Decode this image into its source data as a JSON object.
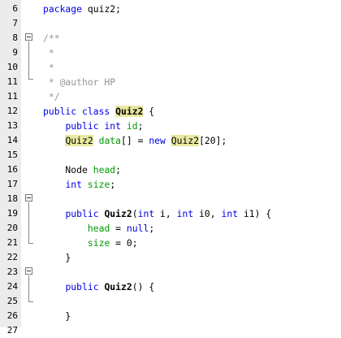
{
  "editor": {
    "lines": [
      {
        "n": "6",
        "parts": [
          [
            "kw",
            "package"
          ],
          [
            "t",
            " quiz2;"
          ]
        ]
      },
      {
        "n": "7",
        "parts": []
      },
      {
        "n": "8",
        "parts": [
          [
            "cm",
            "/**"
          ]
        ]
      },
      {
        "n": "9",
        "parts": [
          [
            "cm",
            " *"
          ]
        ]
      },
      {
        "n": "10",
        "parts": [
          [
            "cm",
            " *"
          ]
        ]
      },
      {
        "n": "11",
        "parts": [
          [
            "cm",
            " * @author HP"
          ]
        ]
      },
      {
        "n": "11",
        "parts": [
          [
            "cm",
            " */"
          ]
        ]
      },
      {
        "n": "12",
        "parts": [
          [
            "kw",
            "public class "
          ],
          [
            "clsb",
            "Quiz2"
          ],
          [
            "t",
            " {"
          ]
        ]
      },
      {
        "n": "13",
        "parts": [
          [
            "t",
            "    "
          ],
          [
            "kw",
            "public int "
          ],
          [
            "fld",
            "id"
          ],
          [
            "t",
            ";"
          ]
        ]
      },
      {
        "n": "14",
        "parts": [
          [
            "t",
            "    "
          ],
          [
            "cls",
            "Quiz2"
          ],
          [
            "t",
            " "
          ],
          [
            "fld",
            "data"
          ],
          [
            "t",
            "[] = "
          ],
          [
            "kw",
            "new "
          ],
          [
            "cls",
            "Quiz2"
          ],
          [
            "t",
            "[20];"
          ]
        ]
      },
      {
        "n": "15",
        "parts": []
      },
      {
        "n": "16",
        "parts": [
          [
            "t",
            "    Node "
          ],
          [
            "fld",
            "head"
          ],
          [
            "t",
            ";"
          ]
        ]
      },
      {
        "n": "17",
        "parts": [
          [
            "t",
            "    "
          ],
          [
            "kw",
            "int "
          ],
          [
            "fld",
            "size"
          ],
          [
            "t",
            ";"
          ]
        ]
      },
      {
        "n": "18",
        "parts": []
      },
      {
        "n": "19",
        "parts": [
          [
            "t",
            "    "
          ],
          [
            "kw",
            "public "
          ],
          [
            "b",
            "Quiz2"
          ],
          [
            "t",
            "("
          ],
          [
            "kw",
            "int "
          ],
          [
            "t",
            "i, "
          ],
          [
            "kw",
            "int "
          ],
          [
            "t",
            "i0, "
          ],
          [
            "kw",
            "int "
          ],
          [
            "t",
            "i1) {"
          ]
        ]
      },
      {
        "n": "20",
        "parts": [
          [
            "t",
            "        "
          ],
          [
            "fld",
            "head"
          ],
          [
            "t",
            " = "
          ],
          [
            "kw",
            "null"
          ],
          [
            "t",
            ";"
          ]
        ]
      },
      {
        "n": "21",
        "parts": [
          [
            "t",
            "        "
          ],
          [
            "fld",
            "size"
          ],
          [
            "t",
            " = 0;"
          ]
        ]
      },
      {
        "n": "22",
        "parts": [
          [
            "t",
            "    }"
          ]
        ]
      },
      {
        "n": "23",
        "parts": []
      },
      {
        "n": "24",
        "parts": [
          [
            "t",
            "    "
          ],
          [
            "kw",
            "public "
          ],
          [
            "b",
            "Quiz2"
          ],
          [
            "t",
            "() {"
          ]
        ]
      },
      {
        "n": "25",
        "parts": []
      },
      {
        "n": "26",
        "parts": [
          [
            "t",
            "    }"
          ]
        ]
      },
      {
        "n": "27",
        "parts": []
      }
    ],
    "fold_icon": "collapse-box-icon"
  }
}
